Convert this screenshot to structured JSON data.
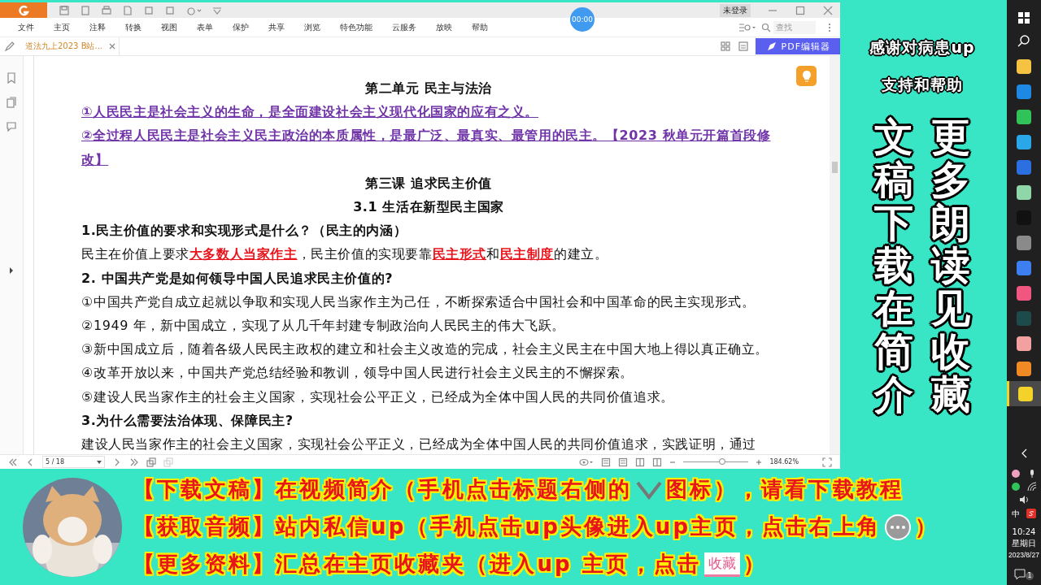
{
  "app": {
    "title_bar": {
      "login": "未登录"
    },
    "recorder": {
      "time": "00:00"
    },
    "menu": [
      "文件",
      "主页",
      "注释",
      "转换",
      "视图",
      "表单",
      "保护",
      "共享",
      "浏览",
      "特色功能",
      "云服务",
      "放映",
      "帮助"
    ],
    "search": {
      "placeholder": "查找"
    },
    "tab": {
      "label": "道法九上2023 B站..."
    },
    "editor_button": "PDF编辑器",
    "document": {
      "lines": [
        {
          "kind": "title",
          "parts": [
            {
              "text": "第二单元  民主与法治"
            }
          ]
        },
        {
          "kind": "key",
          "parts": [
            {
              "text": "①人民民主是社会主义的生命，是全面建设社会主义现代化国家的应有之义。"
            }
          ]
        },
        {
          "kind": "key",
          "parts": [
            {
              "text": "②全过程人民民主是社会主义民主政治的本质属性，是最广泛、最真实、最管用的民主。【2023 秋单元开篇首段修改】"
            }
          ]
        },
        {
          "kind": "title",
          "parts": [
            {
              "text": "第三课  追求民主价值"
            }
          ]
        },
        {
          "kind": "title",
          "parts": [
            {
              "text": "3.1  生活在新型民主国家"
            }
          ]
        },
        {
          "kind": "heading",
          "parts": [
            {
              "text": "1.民主价值的要求和实现形式是什么？（民主的内涵）"
            }
          ]
        },
        {
          "kind": "body",
          "parts": [
            {
              "text": "民主在价值上要求"
            },
            {
              "text": "大多数人当家作主",
              "emphasis": true
            },
            {
              "text": "，民主价值的实现要靠"
            },
            {
              "text": "民主形式",
              "emphasis": true
            },
            {
              "text": "和"
            },
            {
              "text": "民主制度",
              "emphasis": true
            },
            {
              "text": "的建立。"
            }
          ]
        },
        {
          "kind": "heading",
          "parts": [
            {
              "text": "2.  中国共产党是如何领导中国人民追求民主价值的?"
            }
          ]
        },
        {
          "kind": "body",
          "parts": [
            {
              "text": "①中国共产党自成立起就以争取和实现人民当家作主为己任，不断探索适合中国社会和中国革命的民主实现形式。"
            }
          ]
        },
        {
          "kind": "body",
          "parts": [
            {
              "text": "②1949 年，新中国成立，实现了从几千年封建专制政治向人民民主的伟大飞跃。"
            }
          ]
        },
        {
          "kind": "body",
          "parts": [
            {
              "text": "③新中国成立后，随着各级人民民主政权的建立和社会主义改造的完成，社会主义民主在中国大地上得以真正确立。"
            }
          ]
        },
        {
          "kind": "body",
          "parts": [
            {
              "text": "④改革开放以来，中国共产党总结经验和教训，领导中国人民进行社会主义民主的不懈探索。"
            }
          ]
        },
        {
          "kind": "body",
          "parts": [
            {
              "text": "⑤建设人民当家作主的社会主义国家，实现社会公平正义，已经成为全体中国人民的共同价值追求。"
            }
          ]
        },
        {
          "kind": "heading",
          "parts": [
            {
              "text": "3.为什么需要法治体现、保障民主?"
            }
          ]
        },
        {
          "kind": "body",
          "parts": [
            {
              "text": "建设人民当家作主的社会主义国家，实现社会公平正义，已经成为全体中国人民的共同价值追求，实践证明，通过"
            }
          ]
        }
      ]
    },
    "status_bar": {
      "page": "5 / 18",
      "zoom_slider": {
        "level": 0.6
      },
      "zoom": "184.62%"
    }
  },
  "promo": {
    "lines": [
      "感谢对病患up",
      "支持和帮助"
    ],
    "columns": [
      "文稿下载在简介",
      "更多朗读见收藏"
    ]
  },
  "banner": {
    "lines": [
      {
        "parts": [
          {
            "kind": "text",
            "text": "【下载文稿】在视频简介（手机点击标题右侧的"
          },
          {
            "kind": "chevron"
          },
          {
            "kind": "text",
            "text": "图标），请看下载教程"
          }
        ]
      },
      {
        "parts": [
          {
            "kind": "text",
            "text": "【获取音频】站内私信up（手机点击up头像进入up主页，点击右上角"
          },
          {
            "kind": "bubble"
          },
          {
            "kind": "text",
            "text": "）"
          }
        ]
      },
      {
        "parts": [
          {
            "kind": "text",
            "text": "【更多资料】汇总在主页收藏夹（进入up 主页，点击"
          },
          {
            "kind": "badge",
            "text": "收藏"
          },
          {
            "kind": "text",
            "text": "）"
          }
        ]
      }
    ]
  },
  "taskbar": {
    "apps": [
      {
        "color": "#f5c242",
        "selected": false
      },
      {
        "color": "#1e88e5",
        "selected": false
      },
      {
        "color": "#2fc35a",
        "selected": false
      },
      {
        "color": "#2aa7e8",
        "selected": false
      },
      {
        "color": "#2b6fe0",
        "selected": false
      },
      {
        "color": "#8fd6a8",
        "selected": false
      },
      {
        "color": "#111111",
        "selected": false
      },
      {
        "color": "#8a8a8a",
        "selected": false
      },
      {
        "color": "#3d7ff0",
        "selected": false
      },
      {
        "color": "#f0567f",
        "selected": false
      },
      {
        "color": "#1d4a4a",
        "selected": false
      },
      {
        "color": "#f2a0a0",
        "selected": false
      },
      {
        "color": "#f08a24",
        "selected": false
      },
      {
        "color": "#f3d22a",
        "selected": true
      }
    ],
    "ime": "中",
    "time": "10:24",
    "weekday": "星期日",
    "date": "2023/8/27",
    "notifications": "1"
  }
}
